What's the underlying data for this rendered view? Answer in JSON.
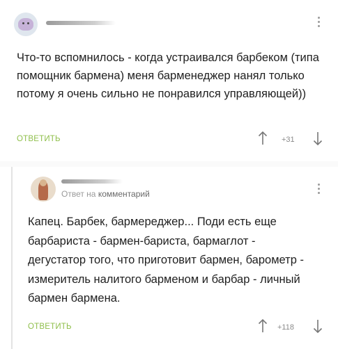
{
  "comment1": {
    "avatar_icon": "user-avatar-icon",
    "text": "Что-то вспомнилось - когда устраивался барбеком (типа помощник бармена) меня барменеджер нанял только потому я очень сильно не понравился управляющей))",
    "reply_label": "ОТВЕТИТЬ",
    "rating": "+31"
  },
  "comment2": {
    "reply_prefix": "Ответ на",
    "reply_target": "комментарий",
    "text": "Капец. Барбек, бармереджер... Поди есть еще барбариста - бармен-бариста, бармаглот - дегустатор того, что приготовит бармен, барометр - измеритель налитого барменом и барбар - личный бармен бармена.",
    "reply_label": "ОТВЕТИТЬ",
    "rating": "+118"
  },
  "colors": {
    "accent": "#8fbf4b",
    "muted": "#9a9a9a",
    "text": "#1f1f1f"
  }
}
